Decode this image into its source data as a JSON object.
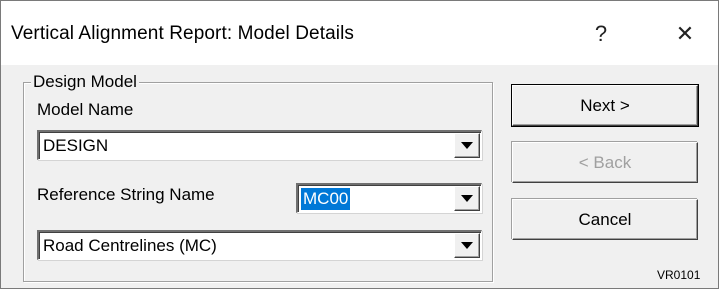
{
  "window": {
    "title": "Vertical Alignment Report: Model Details",
    "help_glyph": "?",
    "close_glyph": "✕"
  },
  "design_model": {
    "group_label": "Design Model",
    "model_name_label": "Model Name",
    "model_name_value": "DESIGN",
    "reference_string_label": "Reference String Name",
    "reference_string_value": "MC00",
    "string_type_value": "Road Centrelines (MC)"
  },
  "buttons": {
    "next": "Next >",
    "back": "< Back",
    "cancel": "Cancel"
  },
  "dialog_code": "VR0101",
  "icons": [
    "help-icon",
    "close-icon",
    "chevron-down-icon"
  ],
  "colors": {
    "selection": "#0078d7",
    "dialog_face": "#f0f0f0",
    "disabled_text": "#a0a0a0"
  }
}
